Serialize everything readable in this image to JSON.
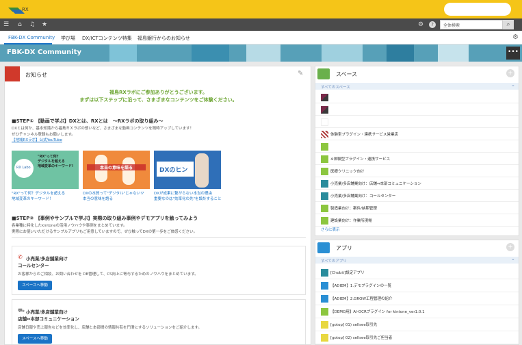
{
  "colors": {
    "accent": "#1a73c6",
    "topbar": "#f5c518",
    "darkbar": "#4b4b4b",
    "notice_icon": "#d0392b",
    "welcome": "#6ca532"
  },
  "header": {
    "logo_text": "RX",
    "search_placeholder": "全体検索",
    "icons": [
      "menu-icon",
      "home-icon",
      "bell-icon",
      "star-icon",
      "gear-icon",
      "help-icon",
      "search-icon"
    ]
  },
  "tabs": [
    {
      "label": "FBK-DX Community"
    },
    {
      "label": "学び場"
    },
    {
      "label": "DX/ICTコンテンツ特集"
    },
    {
      "label": "福島銀行からのお知らせ"
    }
  ],
  "banner": {
    "title": "FBK-DX Community",
    "more": "•••"
  },
  "notice": {
    "title": "お知らせ",
    "welcome_line1": "福島RXラボにご参加ありがとうございます。",
    "welcome_line2": "まずは以下ステップに沿って、さまざまなコンテンツをご体験ください。",
    "step1_heading": "■STEP① 【動画で学ぶ】DXとは、RXとは　～RXラボの取り組み～",
    "step1_text1": "DXとは何か、基本知識から福島ＲＸラボの想いなど、さまざまな動画コンテンツを随時アップしています！",
    "step1_text2": "ぜひチャンネル登録もお願いします。",
    "step1_link": "【地域RXラボ】公式YouTube",
    "thumbs": [
      {
        "overlay": "\"RX\"って何?\nデジタルを超える\n地域変革のキーワード!",
        "caption1": "\"RX\"って何？デジタルを超える",
        "caption2": "地域変革のキーワード！",
        "badge": "RX Labo"
      },
      {
        "overlay": "本当の意味を語る",
        "caption1": "DXの本質って\"デジタル\"じゃない!?",
        "caption2": "本当の意味を語る",
        "badge": ""
      },
      {
        "overlay": "DXのヒン",
        "caption1": "DXが成果に繋がらない本当の理由",
        "caption2": "重要なのは\"効率化の先\"を設計すること",
        "badge": ""
      }
    ],
    "step2_heading": "■STEP② 【事例やサンプルで学ぶ】実際の取り組み事例やデモアプリを触ってみよう",
    "step2_text1": "各業種に特化したkintoneの活用ノウハウや事例をまとめています。",
    "step2_text2": "実際にお使いいただけるサンプルアプリもご用意していますので、ぜひ触ってDXの第一歩をご体感ください。",
    "cases": [
      {
        "line1": "小売業/多店舗業向け",
        "line2": "コールセンター",
        "desc": "お客様からのご相談、お問い合わせを DB管理して、CS向上に寄与するためのノウハウをまとめています。",
        "button": "スペースへ移動"
      },
      {
        "line1": "小売業/多店舗業向け",
        "line2": "店舗⇔本部コミュニケーション",
        "desc": "店舗日報や売上報告などを効率化し、店舗と本部間の情報共有を円滑にするソリューションをご紹介します。",
        "button": "スペースへ移動"
      }
    ]
  },
  "spaces": {
    "title": "スペース",
    "filter": "すべてのスペース",
    "items": [
      {
        "label": "",
        "icon": "triangle"
      },
      {
        "label": "",
        "icon": "triangle"
      },
      {
        "label": "",
        "icon": "blank"
      },
      {
        "label": "体験型プラグイン・連携サービス営業店",
        "icon": "grid"
      },
      {
        "label": "",
        "icon": "green"
      },
      {
        "label": "※体験型プラグイン・連携サービス",
        "icon": "green"
      },
      {
        "label": "医療クリニック向け",
        "icon": "green"
      },
      {
        "label": "小売業/多店舗業向け：店舗⇔本部コミュニケーション",
        "icon": "teal"
      },
      {
        "label": "小売業/多店舗業向け：コールセンター",
        "icon": "teal"
      },
      {
        "label": "製造業向け：案件/納期管理",
        "icon": "green"
      },
      {
        "label": "建設業向け：作業所現場",
        "icon": "green"
      }
    ],
    "more": "さらに表示"
  },
  "apps": {
    "title": "アプリ",
    "filter": "すべてのアプリ",
    "items": [
      {
        "label": "[Chobit]設定アプリ",
        "icon": "teal"
      },
      {
        "label": "【ADIEM】1.デモプラグインの一覧",
        "icon": "blue"
      },
      {
        "label": "【ADIEM】2.GROW工程管理の紹介",
        "icon": "blue"
      },
      {
        "label": "【DEMO用】AI-OCRプラグイン for kintone_ver1.0.1",
        "icon": "green"
      },
      {
        "label": "[gotop] 01) sellsee取引先",
        "icon": "yellow"
      },
      {
        "label": "[gotop] 02) sellsee取引先ご担当者",
        "icon": "yellow"
      }
    ]
  }
}
